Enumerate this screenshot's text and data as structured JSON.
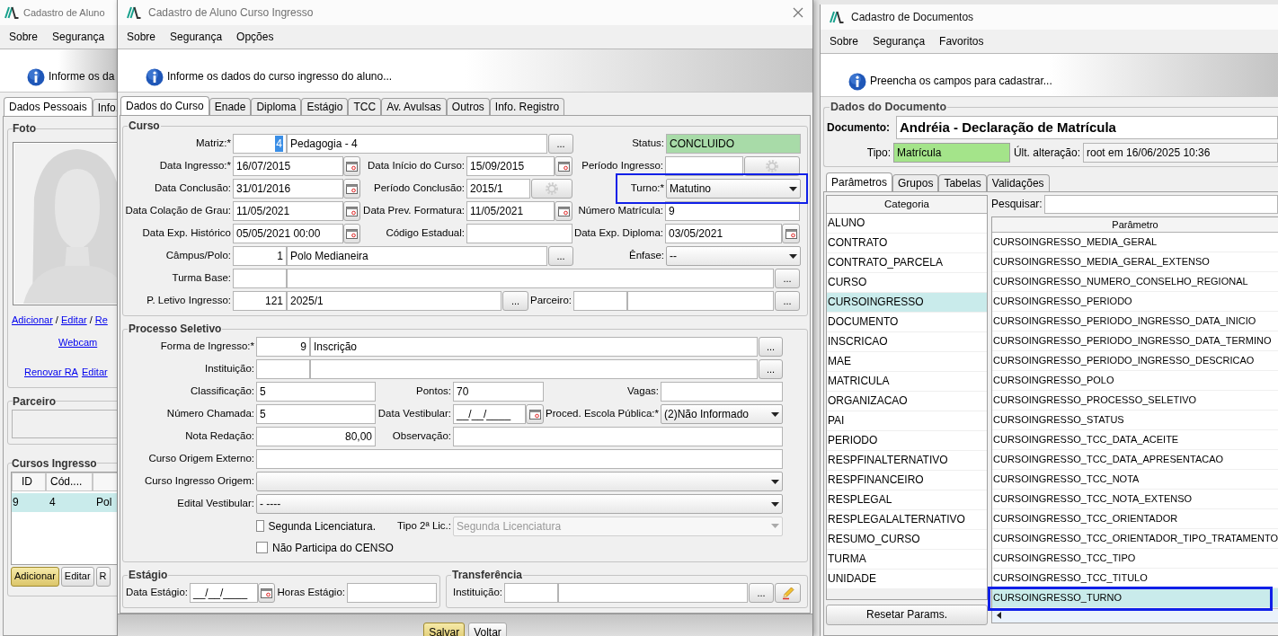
{
  "student_window": {
    "title": "Cadastro de Aluno",
    "menu": [
      "Sobre",
      "Segurança"
    ],
    "info": "Informe os da",
    "tabs": [
      {
        "label": "Dados Pessoais",
        "selected": true
      },
      {
        "label": "Info.",
        "selected": false
      }
    ],
    "photo": {
      "title": "Foto",
      "links": [
        [
          {
            "kind": "link",
            "text": "Adicionar"
          },
          {
            "kind": "text",
            "text": "/"
          },
          {
            "kind": "link",
            "text": "Editar"
          },
          {
            "kind": "text",
            "text": "/"
          },
          {
            "kind": "link",
            "text": "Re"
          }
        ],
        [
          {
            "kind": "link",
            "text": "Webcam"
          }
        ],
        [
          {
            "kind": "link",
            "text": "Renovar RA"
          },
          {
            "kind": "link",
            "text": "Editar"
          }
        ]
      ]
    },
    "partner": {
      "title": "Parceiro"
    },
    "courses": {
      "title": "Cursos Ingresso",
      "columns": [
        "ID",
        "Cód...."
      ],
      "rows": [
        {
          "cells": [
            "9",
            "4",
            "Pol"
          ],
          "selected": true
        }
      ],
      "buttons": [
        {
          "label": "Adicionar",
          "primary": true
        },
        {
          "label": "Editar",
          "primary": false
        },
        {
          "label": "R",
          "primary": false
        }
      ]
    }
  },
  "course_window": {
    "title": "Cadastro de Aluno Curso Ingresso",
    "menu": [
      "Sobre",
      "Segurança",
      "Opções"
    ],
    "info": "Informe os dados do curso ingresso do aluno...",
    "tabs": [
      {
        "label": "Dados do Curso",
        "selected": true
      },
      {
        "label": "Enade",
        "selected": false
      },
      {
        "label": "Diploma",
        "selected": false
      },
      {
        "label": "Estágio",
        "selected": false
      },
      {
        "label": "TCC",
        "selected": false
      },
      {
        "label": "Av. Avulsas",
        "selected": false
      },
      {
        "label": "Outros",
        "selected": false
      },
      {
        "label": "Info. Registro",
        "selected": false
      }
    ],
    "groups": [
      {
        "title": "Curso",
        "rows": [
          [
            {
              "label": "Matriz:*",
              "controls": [
                {
                  "kind": "code",
                  "value": "4",
                  "text_selected": true
                },
                {
                  "kind": "input",
                  "value": "Pedagogia - 4"
                },
                {
                  "kind": "dots",
                  "label": "..."
                }
              ]
            },
            {
              "label": "Status:",
              "controls": [
                {
                  "kind": "status",
                  "value": "CONCLUIDO"
                }
              ]
            }
          ],
          [
            {
              "label": "Data Ingresso:*",
              "controls": [
                {
                  "kind": "input",
                  "value": "16/07/2015"
                },
                {
                  "kind": "calendar"
                }
              ]
            },
            {
              "label": "Data Início do Curso:",
              "controls": [
                {
                  "kind": "input",
                  "value": "15/09/2015"
                },
                {
                  "kind": "calendar"
                }
              ]
            },
            {
              "label": "Período Ingresso:",
              "controls": [
                {
                  "kind": "input"
                },
                {
                  "kind": "gear"
                }
              ]
            }
          ],
          [
            {
              "label": "Data Conclusão:",
              "controls": [
                {
                  "kind": "input",
                  "value": "31/01/2016"
                },
                {
                  "kind": "calendar"
                }
              ]
            },
            {
              "label": "Período Conclusão:",
              "controls": [
                {
                  "kind": "input",
                  "value": "2015/1"
                },
                {
                  "kind": "gear"
                }
              ]
            },
            {
              "label": "Turno:*",
              "controls": [
                {
                  "kind": "select",
                  "value": "Matutino",
                  "highlighted": true
                }
              ]
            }
          ],
          [
            {
              "label": "Data Colação de Grau:",
              "controls": [
                {
                  "kind": "input",
                  "value": "11/05/2021"
                },
                {
                  "kind": "calendar"
                }
              ]
            },
            {
              "label": "Data Prev. Formatura:",
              "controls": [
                {
                  "kind": "input",
                  "value": "11/05/2021"
                },
                {
                  "kind": "calendar"
                }
              ]
            },
            {
              "label": "Número Matrícula:",
              "controls": [
                {
                  "kind": "input",
                  "value": "9"
                }
              ]
            }
          ],
          [
            {
              "label": "Data Exp. Histórico",
              "controls": [
                {
                  "kind": "input",
                  "value": "05/05/2021 00:00"
                },
                {
                  "kind": "calendar"
                }
              ]
            },
            {
              "label": "Código Estadual:",
              "controls": [
                {
                  "kind": "input"
                }
              ]
            },
            {
              "label": "Data Exp. Diploma:",
              "controls": [
                {
                  "kind": "input",
                  "value": "03/05/2021"
                },
                {
                  "kind": "calendar"
                }
              ]
            }
          ],
          [
            {
              "label": "Câmpus/Polo:",
              "controls": [
                {
                  "kind": "code",
                  "value": "1"
                },
                {
                  "kind": "input",
                  "value": "Polo Medianeira"
                },
                {
                  "kind": "dots",
                  "label": "..."
                }
              ]
            },
            {
              "label": "Ênfase:",
              "controls": [
                {
                  "kind": "select",
                  "value": "--"
                }
              ]
            }
          ],
          [
            {
              "label": "Turma Base:",
              "controls": [
                {
                  "kind": "code"
                },
                {
                  "kind": "input"
                },
                {
                  "kind": "dots",
                  "label": "..."
                }
              ]
            }
          ],
          [
            {
              "label": "P. Letivo Ingresso:",
              "controls": [
                {
                  "kind": "code",
                  "value": "121"
                },
                {
                  "kind": "input",
                  "value": "2025/1"
                },
                {
                  "kind": "dots",
                  "label": "..."
                }
              ]
            },
            {
              "label": "Parceiro:",
              "controls": [
                {
                  "kind": "code"
                },
                {
                  "kind": "input"
                },
                {
                  "kind": "dots",
                  "label": "..."
                }
              ]
            }
          ]
        ]
      },
      {
        "title": "Processo Seletivo",
        "rows": [
          [
            {
              "label": "Forma de Ingresso:*",
              "controls": [
                {
                  "kind": "code",
                  "value": "9"
                },
                {
                  "kind": "input",
                  "value": "Inscrição"
                },
                {
                  "kind": "dots",
                  "label": "..."
                }
              ]
            }
          ],
          [
            {
              "label": "Instituição:",
              "controls": [
                {
                  "kind": "code"
                },
                {
                  "kind": "input"
                },
                {
                  "kind": "dots",
                  "label": "..."
                }
              ]
            }
          ],
          [
            {
              "label": "Classificação:",
              "controls": [
                {
                  "kind": "input",
                  "value": "5"
                }
              ]
            },
            {
              "label": "Pontos:",
              "controls": [
                {
                  "kind": "input",
                  "value": "70"
                }
              ]
            },
            {
              "label": "Vagas:",
              "controls": [
                {
                  "kind": "input"
                }
              ]
            }
          ],
          [
            {
              "label": "Número Chamada:",
              "controls": [
                {
                  "kind": "input",
                  "value": "5"
                }
              ]
            },
            {
              "label": "Data Vestibular:",
              "controls": [
                {
                  "kind": "input",
                  "value": "__/__/____"
                },
                {
                  "kind": "calendar"
                }
              ]
            },
            {
              "label": "Proced. Escola Pública:*",
              "controls": [
                {
                  "kind": "select",
                  "value": "(2)Não Informado"
                }
              ]
            }
          ],
          [
            {
              "label": "Nota Redação:",
              "controls": [
                {
                  "kind": "number",
                  "value": "80,00"
                }
              ]
            },
            {
              "label": "Observação:",
              "controls": [
                {
                  "kind": "input"
                }
              ]
            }
          ],
          [
            {
              "label": "Curso Origem Externo:",
              "controls": [
                {
                  "kind": "input"
                }
              ]
            }
          ],
          [
            {
              "label": "Curso Ingresso Origem:",
              "controls": [
                {
                  "kind": "select"
                }
              ]
            }
          ],
          [
            {
              "label": "Edital Vestibular:",
              "controls": [
                {
                  "kind": "select",
                  "value": "- ----"
                }
              ]
            }
          ],
          [
            {
              "controls": [
                {
                  "kind": "checkbox",
                  "label": "Segunda Licenciatura.",
                  "checked": false
                }
              ]
            },
            {
              "label": "Tipo 2ª Lic.:",
              "controls": [
                {
                  "kind": "select",
                  "value": "Segunda Licenciatura",
                  "disabled": true
                }
              ]
            }
          ],
          [
            {
              "controls": [
                {
                  "kind": "checkbox",
                  "label": "Não Participa do CENSO",
                  "checked": false
                }
              ]
            }
          ]
        ]
      },
      {
        "title": "Estágio",
        "rows": [
          [
            {
              "label": "Data Estágio:",
              "controls": [
                {
                  "kind": "input",
                  "value": "__/__/____"
                },
                {
                  "kind": "calendar"
                }
              ]
            },
            {
              "label": "Horas Estágio:",
              "controls": [
                {
                  "kind": "input"
                }
              ]
            }
          ]
        ]
      },
      {
        "title": "Transferência",
        "rows": [
          [
            {
              "label": "Instituição:",
              "controls": [
                {
                  "kind": "code"
                },
                {
                  "kind": "input"
                },
                {
                  "kind": "dots",
                  "label": "..."
                },
                {
                  "kind": "pencil"
                }
              ]
            }
          ]
        ]
      }
    ],
    "buttons": [
      {
        "label": "Salvar",
        "primary": true
      },
      {
        "label": "Voltar",
        "primary": false
      }
    ]
  },
  "document_window": {
    "title": "Cadastro de Documentos",
    "menu": [
      "Sobre",
      "Segurança",
      "Favoritos"
    ],
    "info": "Preencha os campos para cadastrar...",
    "document_group": {
      "title": "Dados do Documento",
      "document_label": "Documento:",
      "document_value": "Andréia - Declaração de Matrícula",
      "type_label": "Tipo:",
      "type_value": "Matrícula",
      "modified_label": "Últ. alteração:",
      "modified_value": "root em 16/06/2025 10:36"
    },
    "tabs": [
      {
        "label": "Parâmetros",
        "selected": true
      },
      {
        "label": "Grupos",
        "selected": false
      },
      {
        "label": "Tabelas",
        "selected": false
      },
      {
        "label": "Validações",
        "selected": false
      }
    ],
    "categories": {
      "header": "Categoria",
      "items": [
        {
          "label": "ALUNO",
          "selected": false
        },
        {
          "label": "CONTRATO",
          "selected": false
        },
        {
          "label": "CONTRATO_PARCELA",
          "selected": false
        },
        {
          "label": "CURSO",
          "selected": false
        },
        {
          "label": "CURSOINGRESSO",
          "selected": true
        },
        {
          "label": "DOCUMENTO",
          "selected": false
        },
        {
          "label": "INSCRICAO",
          "selected": false
        },
        {
          "label": "MAE",
          "selected": false
        },
        {
          "label": "MATRICULA",
          "selected": false
        },
        {
          "label": "ORGANIZACAO",
          "selected": false
        },
        {
          "label": "PAI",
          "selected": false
        },
        {
          "label": "PERIODO",
          "selected": false
        },
        {
          "label": "RESPFINALTERNATIVO",
          "selected": false
        },
        {
          "label": "RESPFINANCEIRO",
          "selected": false
        },
        {
          "label": "RESPLEGAL",
          "selected": false
        },
        {
          "label": "RESPLEGALALTERNATIVO",
          "selected": false
        },
        {
          "label": "RESUMO_CURSO",
          "selected": false
        },
        {
          "label": "TURMA",
          "selected": false
        },
        {
          "label": "UNIDADE",
          "selected": false
        }
      ]
    },
    "search": {
      "label": "Pesquisar:"
    },
    "parameters": {
      "header": "Parâmetro",
      "rows": [
        {
          "label": "CURSOINGRESSO_MEDIA_GERAL",
          "selected": false,
          "highlighted": false
        },
        {
          "label": "CURSOINGRESSO_MEDIA_GERAL_EXTENSO",
          "selected": false,
          "highlighted": false
        },
        {
          "label": "CURSOINGRESSO_NUMERO_CONSELHO_REGIONAL",
          "selected": false,
          "highlighted": false
        },
        {
          "label": "CURSOINGRESSO_PERIODO",
          "selected": false,
          "highlighted": false
        },
        {
          "label": "CURSOINGRESSO_PERIODO_INGRESSO_DATA_INICIO",
          "selected": false,
          "highlighted": false
        },
        {
          "label": "CURSOINGRESSO_PERIODO_INGRESSO_DATA_TERMINO",
          "selected": false,
          "highlighted": false
        },
        {
          "label": "CURSOINGRESSO_PERIODO_INGRESSO_DESCRICAO",
          "selected": false,
          "highlighted": false
        },
        {
          "label": "CURSOINGRESSO_POLO",
          "selected": false,
          "highlighted": false
        },
        {
          "label": "CURSOINGRESSO_PROCESSO_SELETIVO",
          "selected": false,
          "highlighted": false
        },
        {
          "label": "CURSOINGRESSO_STATUS",
          "selected": false,
          "highlighted": false
        },
        {
          "label": "CURSOINGRESSO_TCC_DATA_ACEITE",
          "selected": false,
          "highlighted": false
        },
        {
          "label": "CURSOINGRESSO_TCC_DATA_APRESENTACAO",
          "selected": false,
          "highlighted": false
        },
        {
          "label": "CURSOINGRESSO_TCC_NOTA",
          "selected": false,
          "highlighted": false
        },
        {
          "label": "CURSOINGRESSO_TCC_NOTA_EXTENSO",
          "selected": false,
          "highlighted": false
        },
        {
          "label": "CURSOINGRESSO_TCC_ORIENTADOR",
          "selected": false,
          "highlighted": false
        },
        {
          "label": "CURSOINGRESSO_TCC_ORIENTADOR_TIPO_TRATAMENTO",
          "selected": false,
          "highlighted": false
        },
        {
          "label": "CURSOINGRESSO_TCC_TIPO",
          "selected": false,
          "highlighted": false
        },
        {
          "label": "CURSOINGRESSO_TCC_TITULO",
          "selected": false,
          "highlighted": false
        },
        {
          "label": "CURSOINGRESSO_TURNO",
          "selected": true,
          "highlighted": true
        }
      ]
    },
    "reset_button": "Resetar Params."
  }
}
